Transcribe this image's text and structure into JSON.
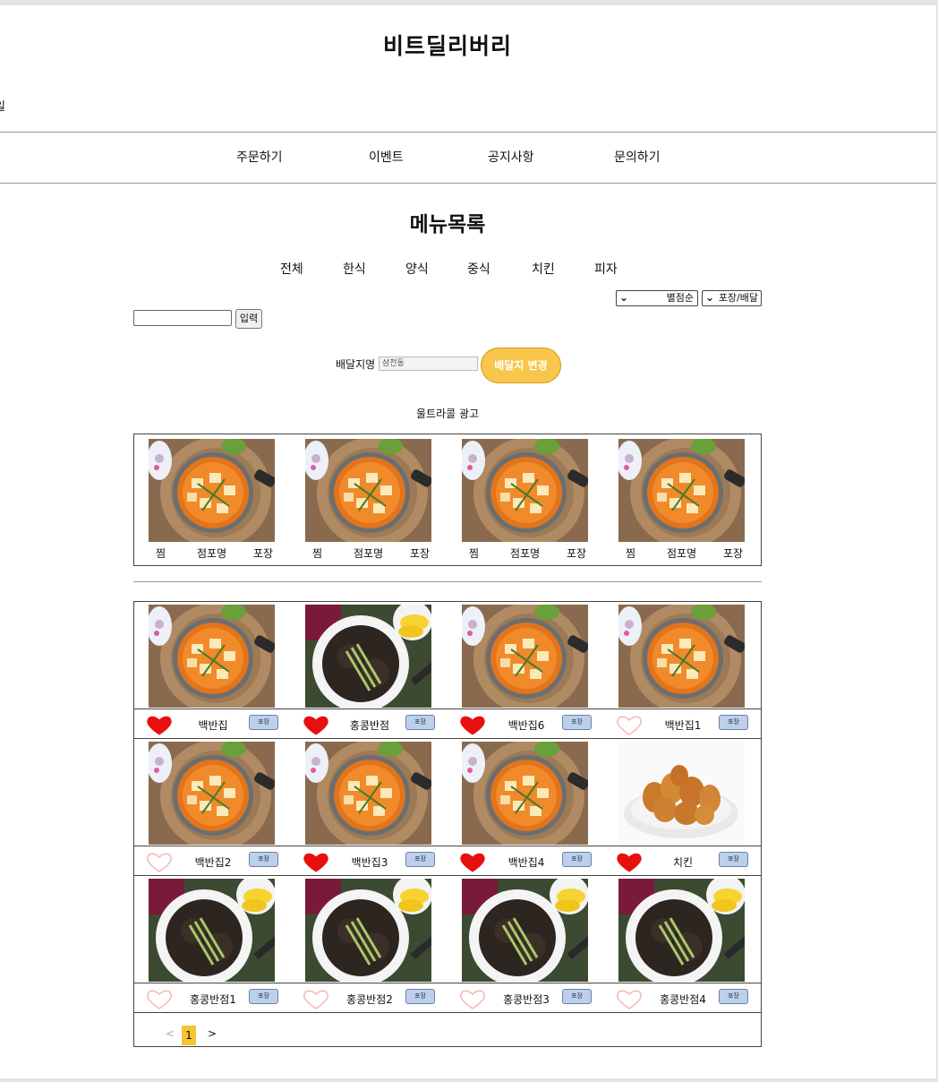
{
  "site": {
    "title": "비트딜리버리",
    "edge_text": "일"
  },
  "nav": {
    "items": [
      "주문하기",
      "이벤트",
      "공지사항",
      "문의하기"
    ]
  },
  "menu": {
    "title": "메뉴목록",
    "categories": [
      "전체",
      "한식",
      "양식",
      "중식",
      "치킨",
      "피자"
    ],
    "sort_select": "별점순",
    "type_select": "포장/배달",
    "search_button": "입력",
    "search_value": ""
  },
  "address": {
    "label": "배달지명",
    "value": "삼전동",
    "change_button": "배달지 변경"
  },
  "ad": {
    "label": "울트라콜 광고",
    "cards": [
      {
        "image": "stew",
        "like": "찜",
        "store": "점포명",
        "pack": "포장"
      },
      {
        "image": "stew",
        "like": "찜",
        "store": "점포명",
        "pack": "포장"
      },
      {
        "image": "stew",
        "like": "찜",
        "store": "점포명",
        "pack": "포장"
      },
      {
        "image": "stew",
        "like": "찜",
        "store": "점포명",
        "pack": "포장"
      }
    ]
  },
  "stores": [
    {
      "image": "stew",
      "liked": true,
      "name": "백반집",
      "pack": "포장"
    },
    {
      "image": "noodle",
      "liked": true,
      "name": "홍콩반점",
      "pack": "포장"
    },
    {
      "image": "stew",
      "liked": true,
      "name": "백반집6",
      "pack": "포장"
    },
    {
      "image": "stew",
      "liked": false,
      "name": "백반집1",
      "pack": "포장"
    },
    {
      "image": "stew",
      "liked": false,
      "name": "백반집2",
      "pack": "포장"
    },
    {
      "image": "stew",
      "liked": true,
      "name": "백반집3",
      "pack": "포장"
    },
    {
      "image": "stew",
      "liked": true,
      "name": "백반집4",
      "pack": "포장"
    },
    {
      "image": "chicken",
      "liked": true,
      "name": "치킨",
      "pack": "포장"
    },
    {
      "image": "noodle",
      "liked": false,
      "name": "홍콩반점1",
      "pack": "포장"
    },
    {
      "image": "noodle",
      "liked": false,
      "name": "홍콩반점2",
      "pack": "포장"
    },
    {
      "image": "noodle",
      "liked": false,
      "name": "홍콩반점3",
      "pack": "포장"
    },
    {
      "image": "noodle",
      "liked": false,
      "name": "홍콩반점4",
      "pack": "포장"
    }
  ],
  "pagination": {
    "prev": "<",
    "current": "1",
    "next": ">"
  },
  "colors": {
    "heart_filled": "#e80f0f",
    "heart_empty": "#f7b5b5",
    "accent": "#f8c64b"
  }
}
